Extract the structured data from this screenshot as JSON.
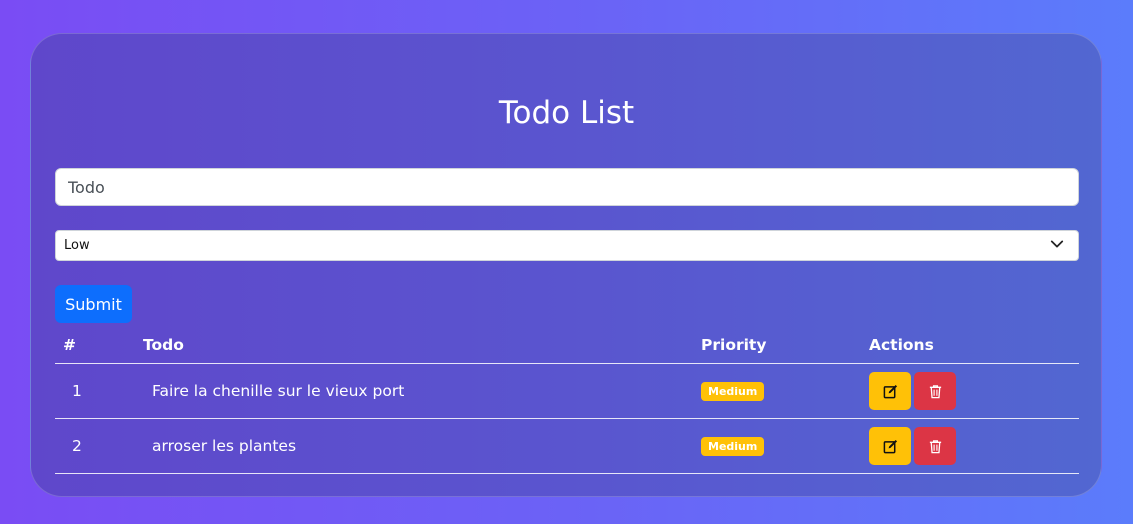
{
  "app": {
    "title": "Todo List"
  },
  "form": {
    "todo_placeholder": "Todo",
    "priority_selected": "Low",
    "submit_label": "Submit"
  },
  "table": {
    "headers": {
      "num": "#",
      "todo": "Todo",
      "priority": "Priority",
      "actions": "Actions"
    },
    "rows": [
      {
        "num": "1",
        "todo": "Faire la chenille sur le vieux port",
        "priority": "Medium"
      },
      {
        "num": "2",
        "todo": "arroser les plantes",
        "priority": "Medium"
      }
    ]
  },
  "icons": {
    "edit": "edit-icon",
    "delete": "trash-icon",
    "dropdown": "chevron-down-icon"
  },
  "colors": {
    "primary": "#0d6efd",
    "warning": "#ffc107",
    "danger": "#dc3545"
  }
}
